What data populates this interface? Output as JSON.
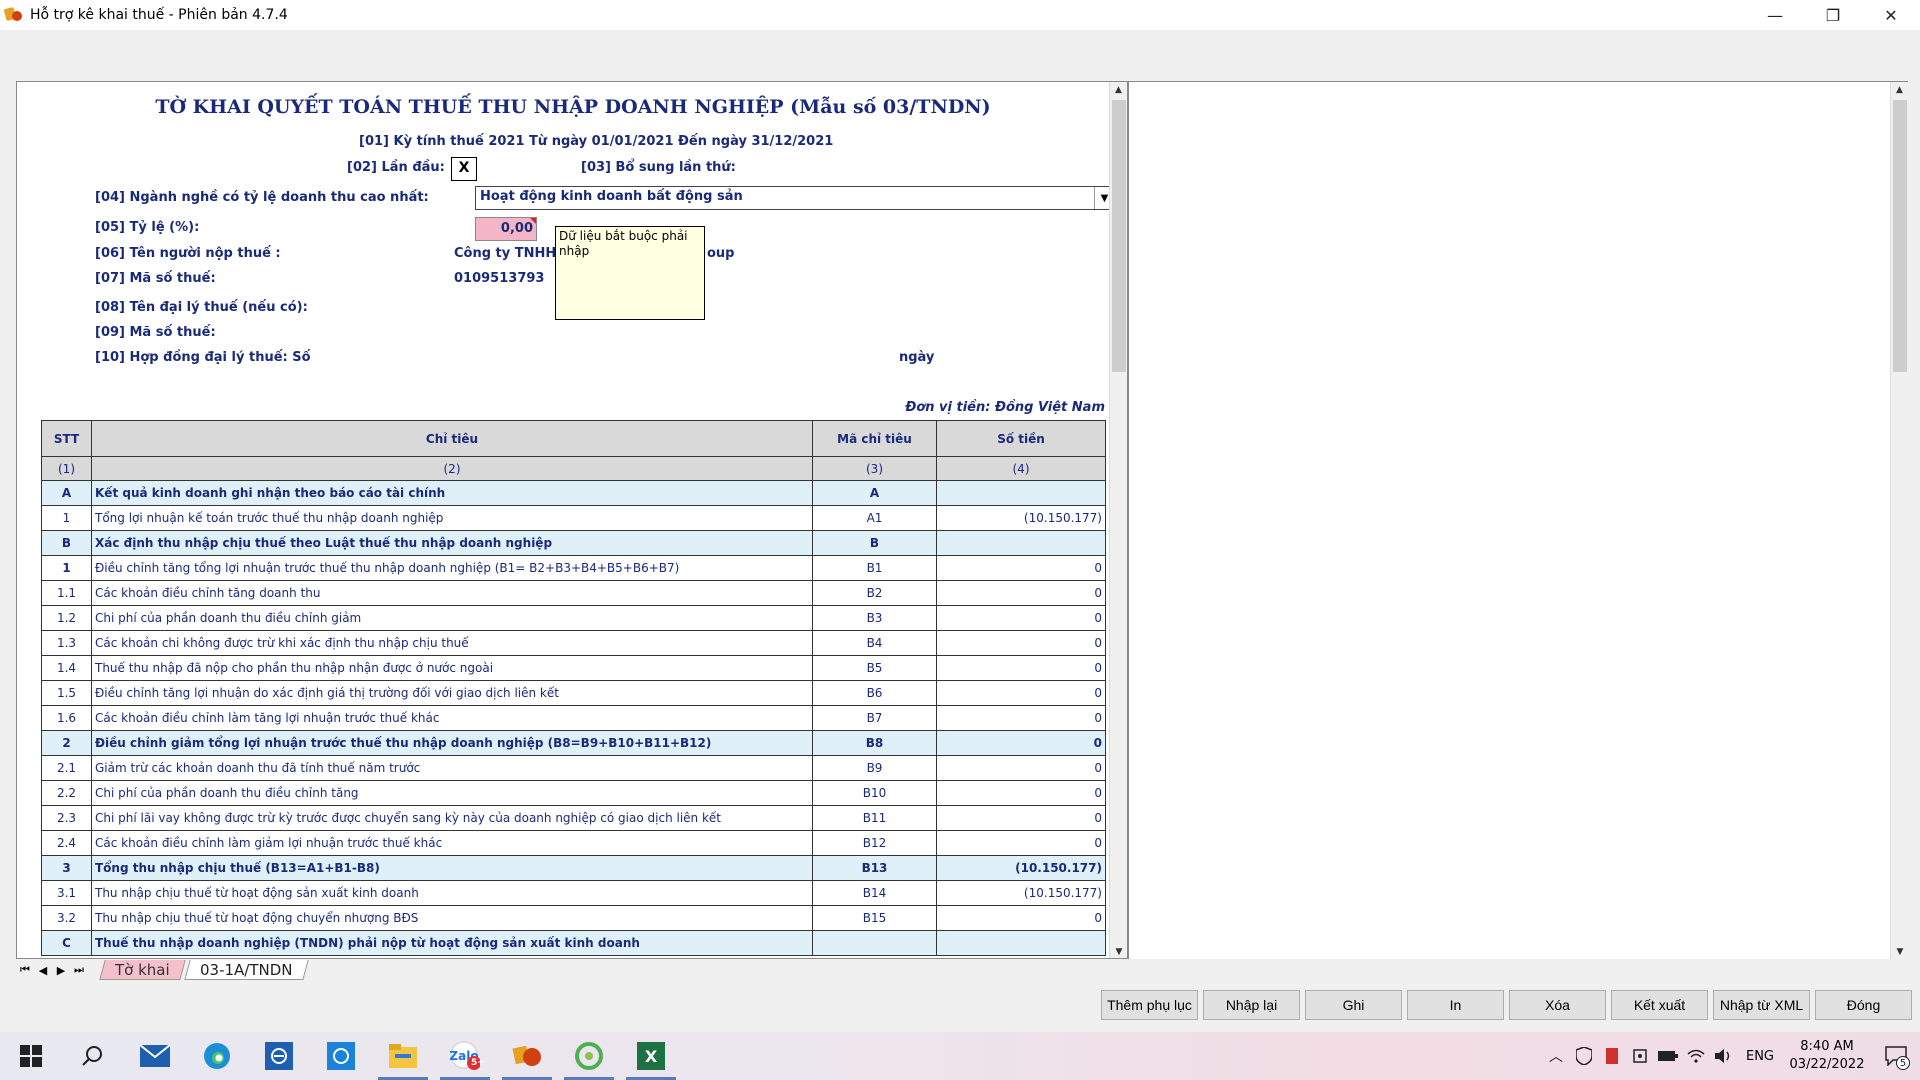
{
  "window": {
    "title": "Hỗ trợ kê khai thuế -  Phiên bản 4.7.4",
    "minimize": "—",
    "restore": "❐",
    "close": "✕"
  },
  "form": {
    "title": "TỜ KHAI QUYẾT TOÁN THUẾ THU NHẬP DOANH NGHIỆP (Mẫu số 03/TNDN)",
    "period": "[01] Kỳ tính thuế 2021 Từ ngày 01/01/2021 Đến ngày 31/12/2021",
    "first_time_label": "[02]   Lần đầu:",
    "first_time_value": "X",
    "supplement_label": "[03]   Bổ sung lần thứ:",
    "industry_label": "[04] Ngành nghề có tỷ lệ doanh thu cao nhất:",
    "industry_value": "Hoạt động kinh doanh bất động sản",
    "rate_label": "[05] Tỷ lệ (%):",
    "rate_value": "0,00",
    "taxpayer_label": "[06] Tên người nộp thuế :",
    "taxpayer_value_a": "Công ty TNHH",
    "taxpayer_value_b": "oup",
    "tax_id_label": "[07] Mã số thuế:",
    "tax_id_value": "0109513793",
    "agent_label": "[08] Tên đại lý thuế (nếu có):",
    "agent_tax_id_label": "[09] Mã số thuế:",
    "contract_label": "[10] Hợp đồng đại lý thuế: Số",
    "contract_date_label": "ngày",
    "tooltip": "Dữ liệu bắt buộc phải nhập",
    "unit": "Đơn vị tiền: Đồng Việt Nam"
  },
  "table": {
    "headers": [
      "STT",
      "Chỉ tiêu",
      "Mã chỉ tiêu",
      "Số tiền"
    ],
    "index_row": [
      "(1)",
      "(2)",
      "(3)",
      "(4)"
    ],
    "rows": [
      {
        "stt": "A",
        "name": "Kết quả kinh doanh ghi nhận theo báo cáo tài chính",
        "code": "A",
        "amount": "",
        "style": "sec"
      },
      {
        "stt": "1",
        "name": "Tổng lợi nhuận kế toán trước thuế thu nhập doanh nghiệp",
        "code": "A1",
        "amount": "(10.150.177)",
        "style": ""
      },
      {
        "stt": "B",
        "name": "Xác định thu nhập chịu thuế theo Luật thuế thu nhập doanh nghiệp",
        "code": "B",
        "amount": "",
        "style": "sec"
      },
      {
        "stt": "1",
        "name": "Điều chỉnh tăng tổng lợi nhuận trước thuế thu nhập doanh nghiệp (B1= B2+B3+B4+B5+B6+B7)",
        "code": "B1",
        "amount": "0",
        "style": "stt-bold"
      },
      {
        "stt": "1.1",
        "name": "Các khoản điều chỉnh tăng doanh thu",
        "code": "B2",
        "amount": "0",
        "style": ""
      },
      {
        "stt": "1.2",
        "name": "Chi phí của phần doanh thu điều chỉnh giảm",
        "code": "B3",
        "amount": "0",
        "style": ""
      },
      {
        "stt": "1.3",
        "name": "Các khoản chi không được trừ khi xác định thu nhập chịu thuế",
        "code": "B4",
        "amount": "0",
        "style": ""
      },
      {
        "stt": "1.4",
        "name": "Thuế thu nhập đã nộp cho phần thu nhập nhận được ở nước ngoài",
        "code": "B5",
        "amount": "0",
        "style": ""
      },
      {
        "stt": "1.5",
        "name": "Điều chỉnh tăng lợi nhuận do xác định giá thị trường đối với giao dịch liên kết",
        "code": "B6",
        "amount": "0",
        "style": ""
      },
      {
        "stt": "1.6",
        "name": "Các khoản điều chỉnh làm tăng lợi nhuận trước thuế khác",
        "code": "B7",
        "amount": "0",
        "style": ""
      },
      {
        "stt": "2",
        "name": "Điều chỉnh giảm tổng lợi nhuận trước thuế thu nhập doanh nghiệp (B8=B9+B10+B11+B12)",
        "code": "B8",
        "amount": "0",
        "style": "sec"
      },
      {
        "stt": "2.1",
        "name": "Giảm trừ các khoản doanh thu đã tính thuế năm trước",
        "code": "B9",
        "amount": "0",
        "style": ""
      },
      {
        "stt": "2.2",
        "name": "Chi phí của phần doanh thu điều chỉnh tăng",
        "code": "B10",
        "amount": "0",
        "style": ""
      },
      {
        "stt": "2.3",
        "name": "Chi phí lãi vay không được trừ kỳ trước được chuyển sang kỳ này của doanh  nghiệp có giao dịch liên kết",
        "code": "B11",
        "amount": "0",
        "style": ""
      },
      {
        "stt": "2.4",
        "name": "Các khoản điều chỉnh làm giảm lợi nhuận trước thuế khác",
        "code": "B12",
        "amount": "0",
        "style": ""
      },
      {
        "stt": "3",
        "name": "Tổng thu nhập chịu thuế (B13=A1+B1-B8)",
        "code": "B13",
        "amount": "(10.150.177)",
        "style": "sec"
      },
      {
        "stt": "3.1",
        "name": "Thu nhập chịu thuế từ hoạt động sản xuất kinh doanh",
        "code": "B14",
        "amount": "(10.150.177)",
        "style": ""
      },
      {
        "stt": "3.2",
        "name": "Thu nhập chịu thuế từ hoạt động chuyển nhượng BĐS",
        "code": "B15",
        "amount": "0",
        "style": ""
      },
      {
        "stt": "C",
        "name": "Thuế thu nhập doanh nghiệp (TNDN) phải nộp từ hoạt động sản xuất kinh doanh",
        "code": "",
        "amount": "",
        "style": "sec"
      }
    ]
  },
  "sheet_tabs": {
    "nav": [
      "⏮",
      "◀",
      "▶",
      "⏭"
    ],
    "tabs": [
      "Tờ khai",
      "03-1A/TNDN"
    ]
  },
  "buttons": [
    "Thêm phụ lục",
    "Nhập lại",
    "Ghi",
    "In",
    "Xóa",
    "Kết xuất",
    "Nhập từ XML",
    "Đóng"
  ],
  "taskbar": {
    "lang": "ENG",
    "time": "8:40 AM",
    "date": "03/22/2022",
    "notif_count": "5",
    "zalo_badge": "5+"
  },
  "colors": {
    "navy_text": "#1a2a7a",
    "section_bg": "#dff0f8",
    "header_bg": "#d9d9d9",
    "required_input": "#f4b6c6",
    "active_tab": "#f4c0cc"
  }
}
